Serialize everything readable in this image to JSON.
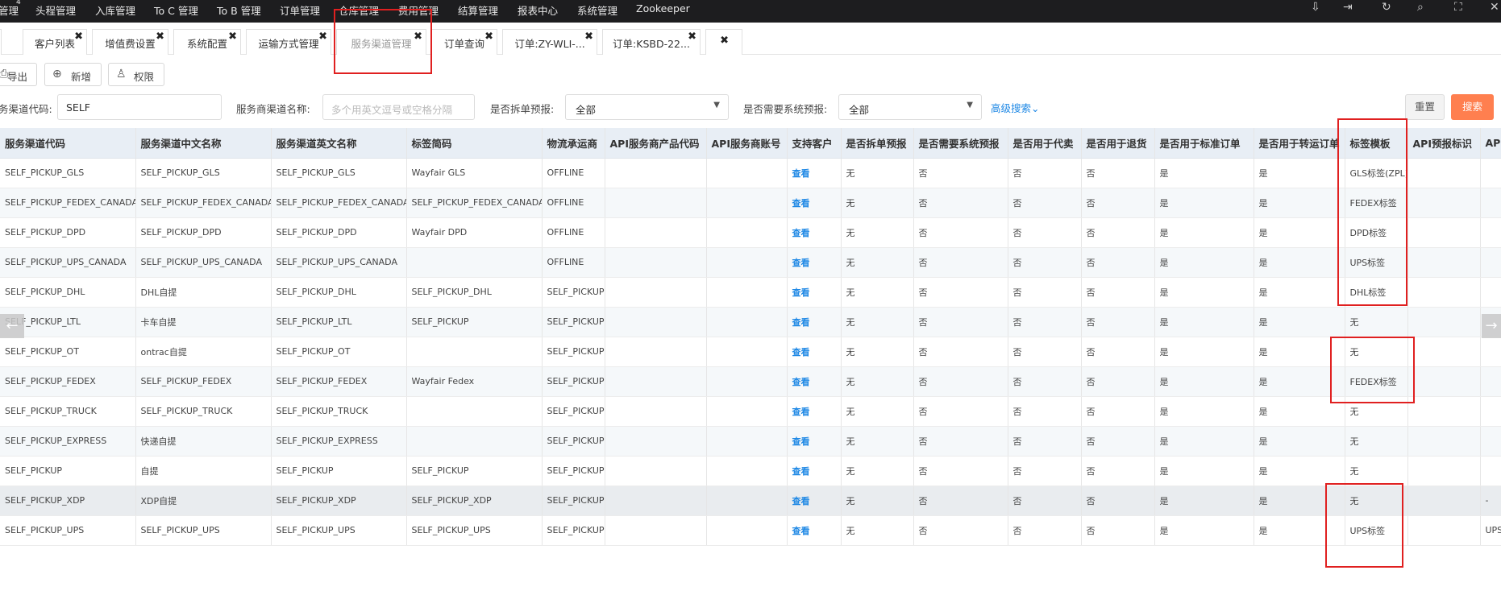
{
  "nav": {
    "items": [
      "管理",
      "头程管理",
      "入库管理",
      "To C 管理",
      "To B 管理",
      "订单管理",
      "仓库管理",
      "费用管理",
      "结算管理",
      "报表中心",
      "系统管理",
      "Zookeeper"
    ],
    "badge": "4"
  },
  "tabs": [
    {
      "label": "客户列表"
    },
    {
      "label": "增值费设置"
    },
    {
      "label": "系统配置"
    },
    {
      "label": "运输方式管理"
    },
    {
      "label": "服务渠道管理"
    },
    {
      "label": "订单查询"
    },
    {
      "label": "订单:ZY-WLI-..."
    },
    {
      "label": "订单:KSBD-22..."
    }
  ],
  "toolbar": {
    "export": "导出",
    "add": "新增",
    "permission": "权限"
  },
  "filters": {
    "channel_code_label": "务渠道代码:",
    "channel_code_value": "SELF",
    "provider_name_label": "服务商渠道名称:",
    "provider_name_placeholder": "多个用英文逗号或空格分隔",
    "split_label": "是否拆单预报:",
    "split_value": "全部",
    "sys_label": "是否需要系统预报:",
    "sys_value": "全部",
    "advanced": "高级搜索",
    "reset": "重置",
    "search": "搜索"
  },
  "table": {
    "columns": [
      "服务渠道代码",
      "服务渠道中文名称",
      "服务渠道英文名称",
      "标签简码",
      "物流承运商",
      "API服务商产品代码",
      "API服务商账号",
      "支持客户",
      "是否拆单预报",
      "是否需要系统预报",
      "是否用于代卖",
      "是否用于退货",
      "是否用于标准订单",
      "是否用于转运订单",
      "标签模板",
      "API预报标识",
      "API"
    ],
    "rows": [
      [
        "SELF_PICKUP_GLS",
        "SELF_PICKUP_GLS",
        "SELF_PICKUP_GLS",
        "Wayfair GLS",
        "OFFLINE",
        "",
        "",
        "查看",
        "无",
        "否",
        "否",
        "否",
        "是",
        "是",
        "GLS标签(ZPL)",
        "",
        ""
      ],
      [
        "SELF_PICKUP_FEDEX_CANADA",
        "SELF_PICKUP_FEDEX_CANADA",
        "SELF_PICKUP_FEDEX_CANADA",
        "SELF_PICKUP_FEDEX_CANADA",
        "OFFLINE",
        "",
        "",
        "查看",
        "无",
        "否",
        "否",
        "否",
        "是",
        "是",
        "FEDEX标签",
        "",
        ""
      ],
      [
        "SELF_PICKUP_DPD",
        "SELF_PICKUP_DPD",
        "SELF_PICKUP_DPD",
        "Wayfair DPD",
        "OFFLINE",
        "",
        "",
        "查看",
        "无",
        "否",
        "否",
        "否",
        "是",
        "是",
        "DPD标签",
        "",
        ""
      ],
      [
        "SELF_PICKUP_UPS_CANADA",
        "SELF_PICKUP_UPS_CANADA",
        "SELF_PICKUP_UPS_CANADA",
        "",
        "OFFLINE",
        "",
        "",
        "查看",
        "无",
        "否",
        "否",
        "否",
        "是",
        "是",
        "UPS标签",
        "",
        ""
      ],
      [
        "SELF_PICKUP_DHL",
        "DHL自提",
        "SELF_PICKUP_DHL",
        "SELF_PICKUP_DHL",
        "SELF_PICKUP",
        "",
        "",
        "查看",
        "无",
        "否",
        "否",
        "否",
        "是",
        "是",
        "DHL标签",
        "",
        ""
      ],
      [
        "SELF_PICKUP_LTL",
        "卡车自提",
        "SELF_PICKUP_LTL",
        "SELF_PICKUP",
        "SELF_PICKUP",
        "",
        "",
        "查看",
        "无",
        "否",
        "否",
        "否",
        "是",
        "是",
        "无",
        "",
        ""
      ],
      [
        "SELF_PICKUP_OT",
        "ontrac自提",
        "SELF_PICKUP_OT",
        "",
        "SELF_PICKUP",
        "",
        "",
        "查看",
        "无",
        "否",
        "否",
        "否",
        "是",
        "是",
        "无",
        "",
        ""
      ],
      [
        "SELF_PICKUP_FEDEX",
        "SELF_PICKUP_FEDEX",
        "SELF_PICKUP_FEDEX",
        "Wayfair Fedex",
        "SELF_PICKUP",
        "",
        "",
        "查看",
        "无",
        "否",
        "否",
        "否",
        "是",
        "是",
        "FEDEX标签",
        "",
        ""
      ],
      [
        "SELF_PICKUP_TRUCK",
        "SELF_PICKUP_TRUCK",
        "SELF_PICKUP_TRUCK",
        "",
        "SELF_PICKUP",
        "",
        "",
        "查看",
        "无",
        "否",
        "否",
        "否",
        "是",
        "是",
        "无",
        "",
        ""
      ],
      [
        "SELF_PICKUP_EXPRESS",
        "快递自提",
        "SELF_PICKUP_EXPRESS",
        "",
        "SELF_PICKUP",
        "",
        "",
        "查看",
        "无",
        "否",
        "否",
        "否",
        "是",
        "是",
        "无",
        "",
        ""
      ],
      [
        "SELF_PICKUP",
        "自提",
        "SELF_PICKUP",
        "SELF_PICKUP",
        "SELF_PICKUP",
        "",
        "",
        "查看",
        "无",
        "否",
        "否",
        "否",
        "是",
        "是",
        "无",
        "",
        ""
      ],
      [
        "SELF_PICKUP_XDP",
        "XDP自提",
        "SELF_PICKUP_XDP",
        "SELF_PICKUP_XDP",
        "SELF_PICKUP",
        "",
        "",
        "查看",
        "无",
        "否",
        "否",
        "否",
        "是",
        "是",
        "无",
        "",
        "-"
      ],
      [
        "SELF_PICKUP_UPS",
        "SELF_PICKUP_UPS",
        "SELF_PICKUP_UPS",
        "SELF_PICKUP_UPS",
        "SELF_PICKUP",
        "",
        "",
        "查看",
        "无",
        "否",
        "否",
        "否",
        "是",
        "是",
        "UPS标签",
        "",
        "UPS"
      ]
    ]
  },
  "colors": {
    "accent": "#ff7f4f",
    "link": "#1e88e5",
    "header_bg": "#e8eef5",
    "annotation": "#e02020"
  }
}
